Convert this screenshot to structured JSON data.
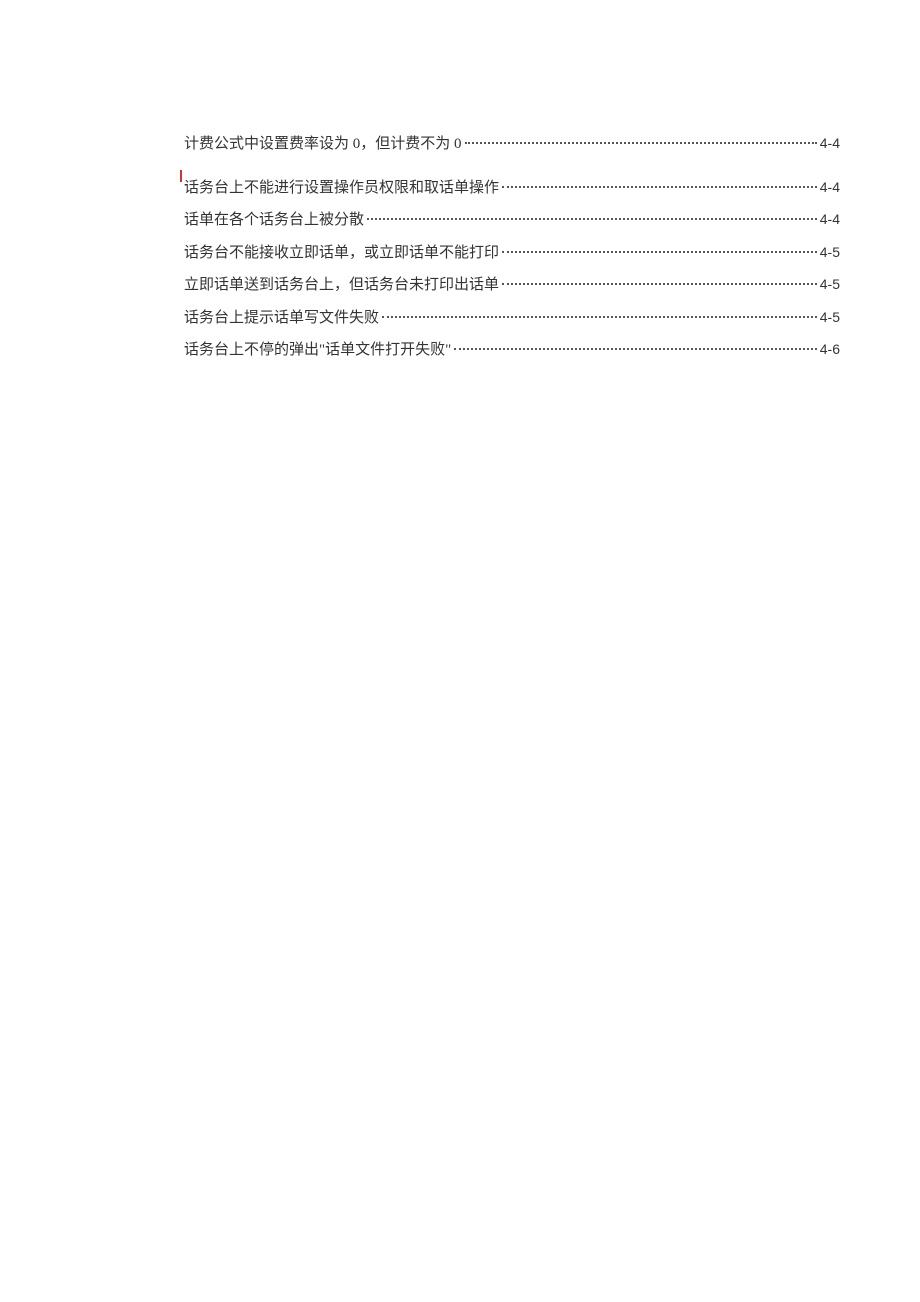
{
  "toc": {
    "entries": [
      {
        "title": "计费公式中设置费率设为 0，但计费不为 0",
        "page": "4-4",
        "first": true
      },
      {
        "title": "话务台上不能进行设置操作员权限和取话单操作",
        "page": "4-4",
        "first": false
      },
      {
        "title": "话单在各个话务台上被分散",
        "page": "4-4",
        "first": false
      },
      {
        "title": "话务台不能接收立即话单，或立即话单不能打印",
        "page": "4-5",
        "first": false
      },
      {
        "title": "立即话单送到话务台上，但话务台未打印出话单",
        "page": "4-5",
        "first": false
      },
      {
        "title": "话务台上提示话单写文件失败",
        "page": "4-5",
        "first": false
      },
      {
        "title": "话务台上不停的弹出\"话单文件打开失败\"",
        "page": "4-6",
        "first": false
      }
    ]
  }
}
